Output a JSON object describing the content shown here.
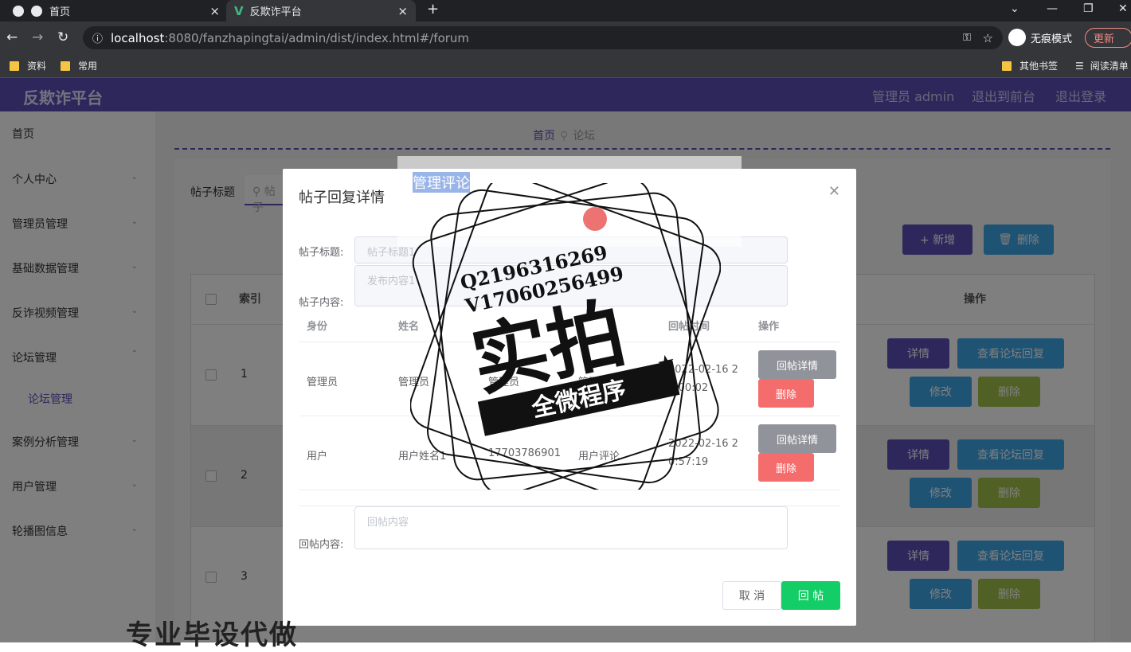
{
  "browser": {
    "tabs": [
      {
        "label": "首页"
      },
      {
        "label": "反欺诈平台"
      }
    ],
    "new_tab": "+",
    "url_host": "localhost",
    "url_rest": ":8080/fanzhapingtai/admin/dist/index.html#/forum",
    "incognito": "无痕模式",
    "update": "更新",
    "bookmarks": [
      "资料",
      "常用"
    ],
    "bookmarks_right": [
      "其他书签",
      "阅读清单"
    ]
  },
  "app": {
    "title": "反欺诈平台",
    "nav": [
      "管理员 admin",
      "退出到前台",
      "退出登录"
    ]
  },
  "sidebar": {
    "items": [
      "首页",
      "个人中心",
      "管理员管理",
      "基础数据管理",
      "反诈视频管理",
      "论坛管理",
      "论坛管理",
      "案例分析管理",
      "用户管理",
      "轮播图信息"
    ]
  },
  "main": {
    "breadcrumb": {
      "home": "首页",
      "current": "论坛"
    },
    "search_label": "帖子标题",
    "search_placeholder": "帖子",
    "add_btn": "+ 新增",
    "del_btn": "删除",
    "headers": {
      "index": "索引",
      "ops": "操作"
    },
    "rows": [
      "1",
      "2",
      "3"
    ],
    "row_btns": {
      "detail": "详情",
      "view": "查看论坛回复",
      "edit": "修改",
      "del": "删除"
    }
  },
  "dialog": {
    "title": "帖子回复详情",
    "title_label": "帖子标题:",
    "title_value": "帖子标题1",
    "content_label": "帖子内容:",
    "content_value": "发布内容1",
    "columns": [
      "身份",
      "姓名",
      "回帖时间",
      "操作"
    ],
    "replies": [
      {
        "role": "管理员",
        "name": "管理员",
        "phone": "管理员",
        "content": "管理评论",
        "time1": "2022-02-16 2",
        "time2": "1:00:02",
        "detail": "回帖详情",
        "del": "删除"
      },
      {
        "role": "用户",
        "name": "用户姓名1",
        "phone": "17703786901",
        "content": "用户评论",
        "time1": "2022-02-16 2",
        "time2": "0:57:19",
        "detail": "回帖详情",
        "del": "删除"
      }
    ],
    "reply_label": "回帖内容:",
    "reply_placeholder": "回帖内容",
    "cancel": "取 消",
    "submit": "回 帖"
  },
  "ghost_text": "管理评论",
  "watermark": {
    "contact1": "Q2196316269",
    "contact2": "V17060256499",
    "big": "实拍",
    "banner": "全微程序"
  },
  "bottom_text": "专业毕设代做"
}
